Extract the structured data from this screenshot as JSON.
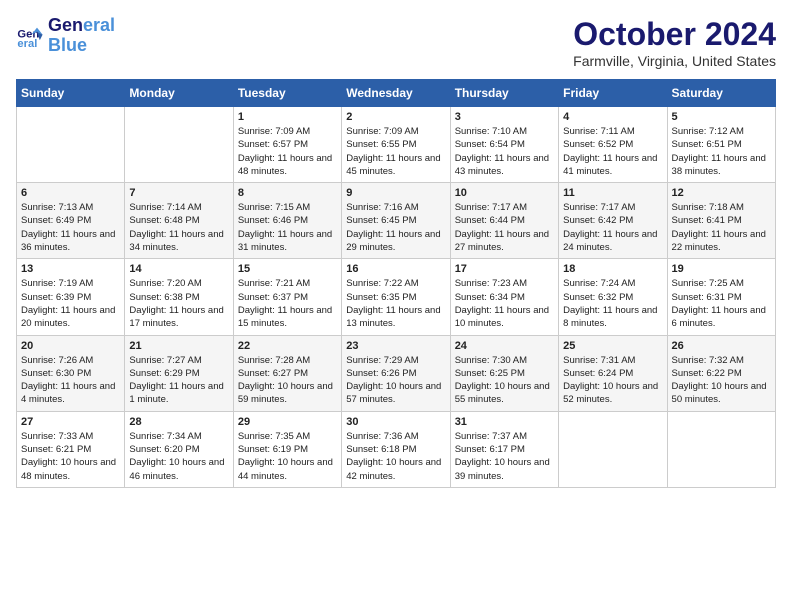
{
  "header": {
    "logo_line1": "General",
    "logo_line2": "Blue",
    "month": "October 2024",
    "location": "Farmville, Virginia, United States"
  },
  "days_of_week": [
    "Sunday",
    "Monday",
    "Tuesday",
    "Wednesday",
    "Thursday",
    "Friday",
    "Saturday"
  ],
  "weeks": [
    [
      {
        "day": "",
        "info": ""
      },
      {
        "day": "",
        "info": ""
      },
      {
        "day": "1",
        "info": "Sunrise: 7:09 AM\nSunset: 6:57 PM\nDaylight: 11 hours and 48 minutes."
      },
      {
        "day": "2",
        "info": "Sunrise: 7:09 AM\nSunset: 6:55 PM\nDaylight: 11 hours and 45 minutes."
      },
      {
        "day": "3",
        "info": "Sunrise: 7:10 AM\nSunset: 6:54 PM\nDaylight: 11 hours and 43 minutes."
      },
      {
        "day": "4",
        "info": "Sunrise: 7:11 AM\nSunset: 6:52 PM\nDaylight: 11 hours and 41 minutes."
      },
      {
        "day": "5",
        "info": "Sunrise: 7:12 AM\nSunset: 6:51 PM\nDaylight: 11 hours and 38 minutes."
      }
    ],
    [
      {
        "day": "6",
        "info": "Sunrise: 7:13 AM\nSunset: 6:49 PM\nDaylight: 11 hours and 36 minutes."
      },
      {
        "day": "7",
        "info": "Sunrise: 7:14 AM\nSunset: 6:48 PM\nDaylight: 11 hours and 34 minutes."
      },
      {
        "day": "8",
        "info": "Sunrise: 7:15 AM\nSunset: 6:46 PM\nDaylight: 11 hours and 31 minutes."
      },
      {
        "day": "9",
        "info": "Sunrise: 7:16 AM\nSunset: 6:45 PM\nDaylight: 11 hours and 29 minutes."
      },
      {
        "day": "10",
        "info": "Sunrise: 7:17 AM\nSunset: 6:44 PM\nDaylight: 11 hours and 27 minutes."
      },
      {
        "day": "11",
        "info": "Sunrise: 7:17 AM\nSunset: 6:42 PM\nDaylight: 11 hours and 24 minutes."
      },
      {
        "day": "12",
        "info": "Sunrise: 7:18 AM\nSunset: 6:41 PM\nDaylight: 11 hours and 22 minutes."
      }
    ],
    [
      {
        "day": "13",
        "info": "Sunrise: 7:19 AM\nSunset: 6:39 PM\nDaylight: 11 hours and 20 minutes."
      },
      {
        "day": "14",
        "info": "Sunrise: 7:20 AM\nSunset: 6:38 PM\nDaylight: 11 hours and 17 minutes."
      },
      {
        "day": "15",
        "info": "Sunrise: 7:21 AM\nSunset: 6:37 PM\nDaylight: 11 hours and 15 minutes."
      },
      {
        "day": "16",
        "info": "Sunrise: 7:22 AM\nSunset: 6:35 PM\nDaylight: 11 hours and 13 minutes."
      },
      {
        "day": "17",
        "info": "Sunrise: 7:23 AM\nSunset: 6:34 PM\nDaylight: 11 hours and 10 minutes."
      },
      {
        "day": "18",
        "info": "Sunrise: 7:24 AM\nSunset: 6:32 PM\nDaylight: 11 hours and 8 minutes."
      },
      {
        "day": "19",
        "info": "Sunrise: 7:25 AM\nSunset: 6:31 PM\nDaylight: 11 hours and 6 minutes."
      }
    ],
    [
      {
        "day": "20",
        "info": "Sunrise: 7:26 AM\nSunset: 6:30 PM\nDaylight: 11 hours and 4 minutes."
      },
      {
        "day": "21",
        "info": "Sunrise: 7:27 AM\nSunset: 6:29 PM\nDaylight: 11 hours and 1 minute."
      },
      {
        "day": "22",
        "info": "Sunrise: 7:28 AM\nSunset: 6:27 PM\nDaylight: 10 hours and 59 minutes."
      },
      {
        "day": "23",
        "info": "Sunrise: 7:29 AM\nSunset: 6:26 PM\nDaylight: 10 hours and 57 minutes."
      },
      {
        "day": "24",
        "info": "Sunrise: 7:30 AM\nSunset: 6:25 PM\nDaylight: 10 hours and 55 minutes."
      },
      {
        "day": "25",
        "info": "Sunrise: 7:31 AM\nSunset: 6:24 PM\nDaylight: 10 hours and 52 minutes."
      },
      {
        "day": "26",
        "info": "Sunrise: 7:32 AM\nSunset: 6:22 PM\nDaylight: 10 hours and 50 minutes."
      }
    ],
    [
      {
        "day": "27",
        "info": "Sunrise: 7:33 AM\nSunset: 6:21 PM\nDaylight: 10 hours and 48 minutes."
      },
      {
        "day": "28",
        "info": "Sunrise: 7:34 AM\nSunset: 6:20 PM\nDaylight: 10 hours and 46 minutes."
      },
      {
        "day": "29",
        "info": "Sunrise: 7:35 AM\nSunset: 6:19 PM\nDaylight: 10 hours and 44 minutes."
      },
      {
        "day": "30",
        "info": "Sunrise: 7:36 AM\nSunset: 6:18 PM\nDaylight: 10 hours and 42 minutes."
      },
      {
        "day": "31",
        "info": "Sunrise: 7:37 AM\nSunset: 6:17 PM\nDaylight: 10 hours and 39 minutes."
      },
      {
        "day": "",
        "info": ""
      },
      {
        "day": "",
        "info": ""
      }
    ]
  ]
}
